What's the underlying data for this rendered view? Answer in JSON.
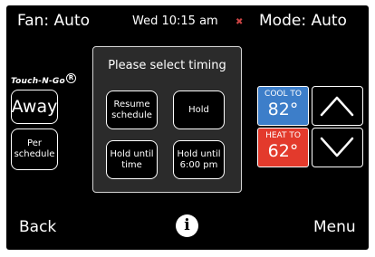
{
  "header": {
    "fan": "Fan: Auto",
    "datetime": "Wed 10:15 am",
    "mode": "Mode: Auto"
  },
  "brand": {
    "name": "Touch-N-Go",
    "reg": "R"
  },
  "left_buttons": {
    "away": "Away",
    "per_schedule": "Per schedule"
  },
  "dialog": {
    "title": "Please select timing",
    "buttons": {
      "resume": "Resume schedule",
      "hold": "Hold",
      "hold_until_time": "Hold until time",
      "hold_until_600": "Hold until 6:00 pm"
    }
  },
  "setpoints": {
    "cool": {
      "label": "COOL TO",
      "value": "82°"
    },
    "heat": {
      "label": "HEAT TO",
      "value": "62°"
    }
  },
  "footer": {
    "back": "Back",
    "info": "i",
    "menu": "Menu"
  },
  "colors": {
    "cool": "#3d7ec9",
    "heat": "#e33a2c",
    "dialog_bg": "#2b2b2b"
  },
  "icons": {
    "up": "chevron-up-icon",
    "down": "chevron-down-icon",
    "wifi": "wifi-icon",
    "info": "info-icon"
  }
}
